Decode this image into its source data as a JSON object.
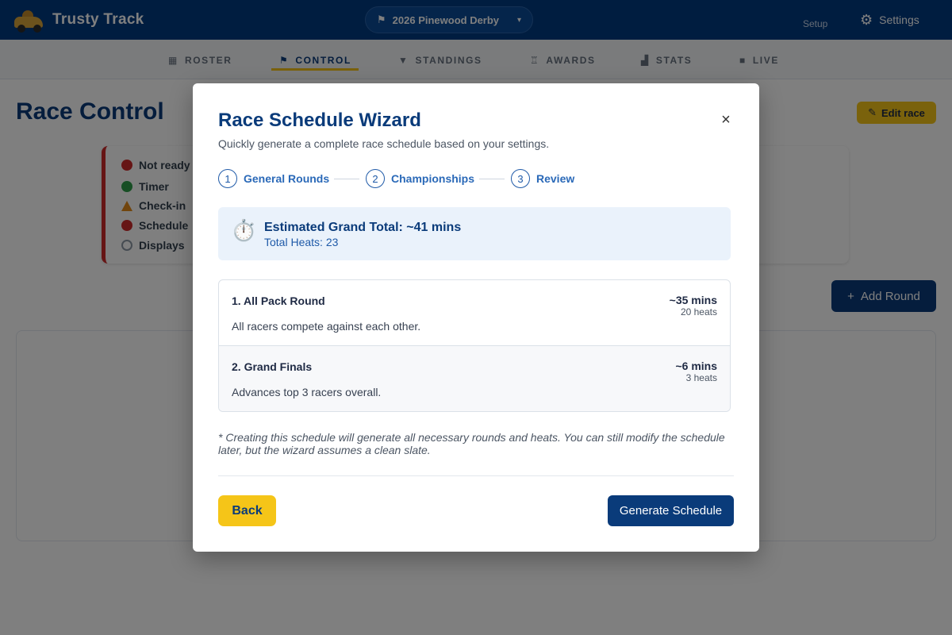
{
  "app": {
    "brand_name": "Trusty Track",
    "event_selector": "2026 Pinewood Derby",
    "setup_label": "Setup",
    "settings_label": "Settings"
  },
  "nav": {
    "items": [
      {
        "label": "ROSTER",
        "icon": "roster-icon"
      },
      {
        "label": "CONTROL",
        "icon": "flag-icon",
        "active": true
      },
      {
        "label": "STANDINGS",
        "icon": "trophy-icon"
      },
      {
        "label": "AWARDS",
        "icon": "award-icon"
      },
      {
        "label": "STATS",
        "icon": "chart-icon"
      },
      {
        "label": "LIVE",
        "icon": "video-icon"
      }
    ]
  },
  "page": {
    "title": "Race Control",
    "edit_race_label": "Edit race",
    "add_round_label": "Add Round",
    "status_items": [
      {
        "label": "Not ready",
        "status": "red"
      },
      {
        "label": "Timer",
        "status": "green"
      },
      {
        "label": "Check-in",
        "status": "warning"
      },
      {
        "label": "Schedule",
        "status": "red"
      },
      {
        "label": "Displays",
        "status": "gray"
      }
    ]
  },
  "modal": {
    "title": "Race Schedule Wizard",
    "subtitle": "Quickly generate a complete race schedule based on your settings.",
    "close_symbol": "×",
    "steps": [
      {
        "number": "1",
        "label": "General Rounds"
      },
      {
        "number": "2",
        "label": "Championships"
      },
      {
        "number": "3",
        "label": "Review"
      }
    ],
    "estimate": {
      "icon": "⏱️",
      "total": "Estimated Grand Total: ~41 mins",
      "heats": "Total Heats: 23"
    },
    "rounds": [
      {
        "name": "1. All Pack Round",
        "description": "All racers compete against each other.",
        "duration": "~35 mins",
        "heats": "20 heats"
      },
      {
        "name": "2. Grand Finals",
        "description": "Advances top 3 racers overall.",
        "duration": "~6 mins",
        "heats": "3 heats"
      }
    ],
    "footnote": "* Creating this schedule will generate all necessary rounds and heats. You can still modify the schedule later, but the wizard assumes a clean slate.",
    "back_label": "Back",
    "generate_label": "Generate Schedule"
  },
  "colors": {
    "primary": "#0a3b7a",
    "accent": "#f5c518",
    "estimate_bg": "#eaf2fb"
  }
}
